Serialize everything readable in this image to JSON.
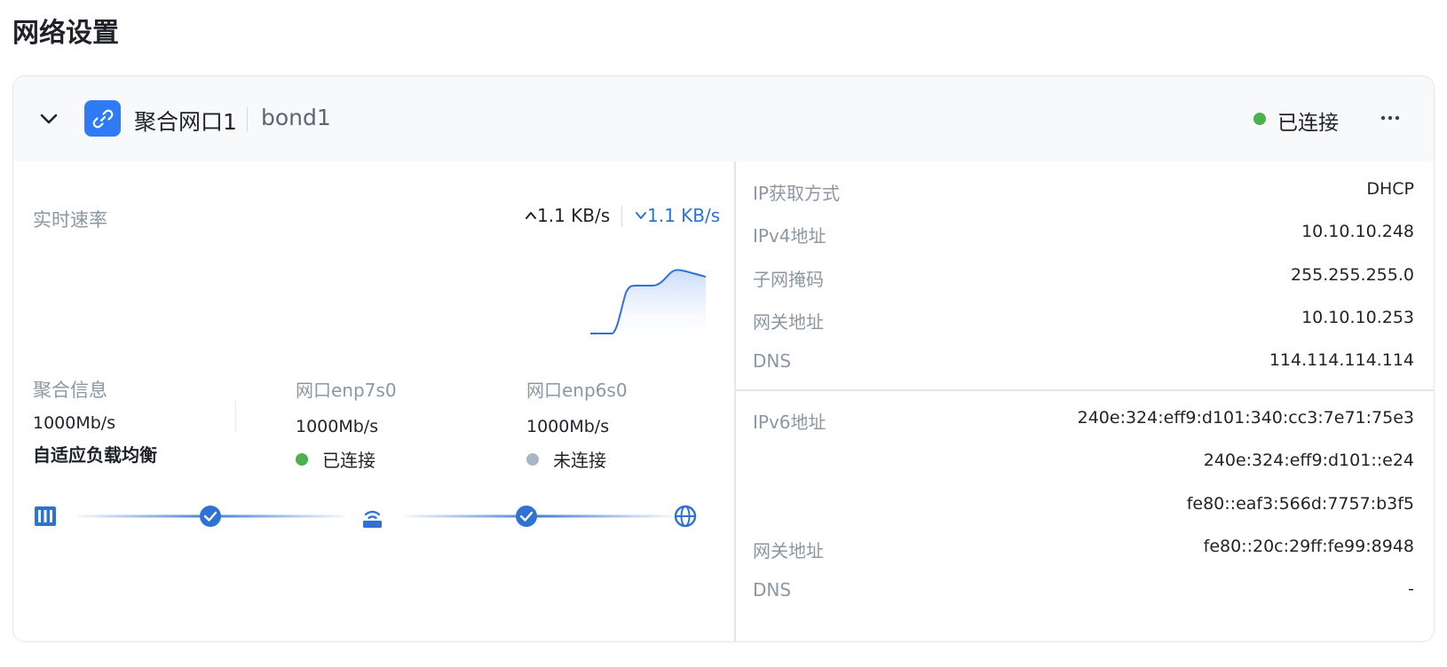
{
  "page": {
    "title": "网络设置"
  },
  "interface": {
    "name": "聚合网口1",
    "id": "bond1",
    "status": "已连接",
    "status_color": "#4caf50",
    "more_label": "···"
  },
  "realtime": {
    "label": "实时速率",
    "upload": "1.1 KB/s",
    "download": "1.1 KB/s",
    "accent": "#2f72d6"
  },
  "aggregation": {
    "title": "聚合信息",
    "speed": "1000Mb/s",
    "mode": "自适应负载均衡"
  },
  "ports": [
    {
      "title": "网口enp7s0",
      "speed": "1000Mb/s",
      "status": "已连接",
      "dot_color": "#4caf50"
    },
    {
      "title": "网口enp6s0",
      "speed": "1000Mb/s",
      "status": "未连接",
      "dot_color": "#a9b6c6"
    }
  ],
  "topology": {
    "icons": [
      "server-icon",
      "check-circle-icon",
      "router-icon",
      "check-circle-icon",
      "globe-icon"
    ]
  },
  "ipv4": [
    {
      "label": "IP获取方式",
      "value": "DHCP"
    },
    {
      "label": "IPv4地址",
      "value": "10.10.10.248"
    },
    {
      "label": "子网掩码",
      "value": "255.255.255.0"
    },
    {
      "label": "网关地址",
      "value": "10.10.10.253"
    },
    {
      "label": "DNS",
      "value": "114.114.114.114"
    }
  ],
  "ipv6": {
    "address_label": "IPv6地址",
    "addresses": [
      "240e:324:eff9:d101:340:cc3:7e71:75e3",
      "240e:324:eff9:d101::e24",
      "fe80::eaf3:566d:7757:b3f5"
    ],
    "gateway_label": "网关地址",
    "gateway": "fe80::20c:29ff:fe99:8948",
    "dns_label": "DNS",
    "dns": "-"
  }
}
